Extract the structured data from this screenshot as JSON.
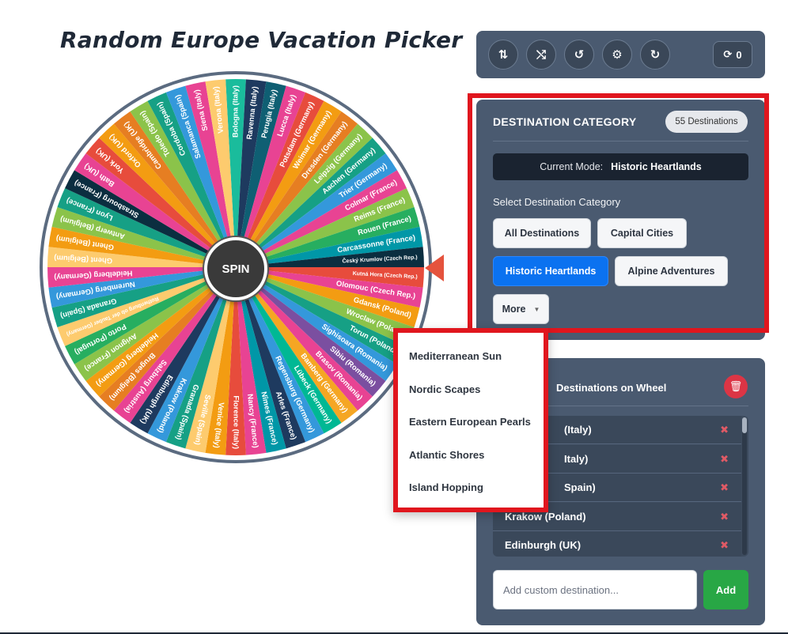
{
  "title": "Random Europe Vacation Picker",
  "wheel": {
    "spin_label": "SPIN",
    "segments": [
      {
        "label": "Bologna (Italy)",
        "color": "#1abc9c"
      },
      {
        "label": "Ravenna (Italy)",
        "color": "#1e3a5f"
      },
      {
        "label": "Perugia (Italy)",
        "color": "#0f5f73"
      },
      {
        "label": "Lucca (Italy)",
        "color": "#e84393"
      },
      {
        "label": "Potsdam (Germany)",
        "color": "#e74c3c"
      },
      {
        "label": "Weimar (Germany)",
        "color": "#f39c12"
      },
      {
        "label": "Dresden (Germany)",
        "color": "#e67e22"
      },
      {
        "label": "Leipzig (Germany)",
        "color": "#8bc34a"
      },
      {
        "label": "Aachen (Germany)",
        "color": "#16a085"
      },
      {
        "label": "Trier (Germany)",
        "color": "#3498db"
      },
      {
        "label": "Colmar (France)",
        "color": "#e84393"
      },
      {
        "label": "Reims (France)",
        "color": "#8bc34a"
      },
      {
        "label": "Rouen (France)",
        "color": "#27ae60"
      },
      {
        "label": "Carcassonne (France)",
        "color": "#0097a7"
      },
      {
        "label": "Český Krumlov (Czech Rep.)",
        "color": "#0b2e40"
      },
      {
        "label": "Kutná Hora (Czech Rep.)",
        "color": "#e74c3c"
      },
      {
        "label": "Olomouc (Czech Rep.)",
        "color": "#e84393"
      },
      {
        "label": "Gdansk (Poland)",
        "color": "#f39c12"
      },
      {
        "label": "Wroclaw (Poland)",
        "color": "#8bc34a"
      },
      {
        "label": "Torun (Poland)",
        "color": "#16a085"
      },
      {
        "label": "Sighisoara (Romania)",
        "color": "#3498db"
      },
      {
        "label": "Sibiu (Romania)",
        "color": "#7b4fa0"
      },
      {
        "label": "Brasov (Romania)",
        "color": "#e84393"
      },
      {
        "label": "Bamberg (Germany)",
        "color": "#f5a623"
      },
      {
        "label": "Lübeck (Germany)",
        "color": "#00b894"
      },
      {
        "label": "Regensburg (Germany)",
        "color": "#3498db"
      },
      {
        "label": "Arles (France)",
        "color": "#1e3a5f"
      },
      {
        "label": "Nîmes (France)",
        "color": "#0097a7"
      },
      {
        "label": "Nancy (France)",
        "color": "#e84393"
      },
      {
        "label": "Florence (Italy)",
        "color": "#e74c3c"
      },
      {
        "label": "Venice (Italy)",
        "color": "#f39c12"
      },
      {
        "label": "Seville (Spain)",
        "color": "#fdcb6e"
      },
      {
        "label": "Granada (Spain)",
        "color": "#16a085"
      },
      {
        "label": "Krakow (Poland)",
        "color": "#3498db"
      },
      {
        "label": "Edinburgh (UK)",
        "color": "#1e3a5f"
      },
      {
        "label": "Salzburg (Austria)",
        "color": "#e84393"
      },
      {
        "label": "Bruges (Belgium)",
        "color": "#e67e22"
      },
      {
        "label": "Heidelberg (Germany)",
        "color": "#f39c12"
      },
      {
        "label": "Avignon (France)",
        "color": "#8bc34a"
      },
      {
        "label": "Porto (Portugal)",
        "color": "#27ae60"
      },
      {
        "label": "Rothenburg ob der Tauber (Germany)",
        "color": "#fdcb6e"
      },
      {
        "label": "Granada (Spain)",
        "color": "#16a085"
      },
      {
        "label": "Nuremberg (Germany)",
        "color": "#3498db"
      },
      {
        "label": "Heidelberg (Germany)",
        "color": "#e84393"
      },
      {
        "label": "Ghent (Belgium)",
        "color": "#fdcb6e"
      },
      {
        "label": "Ghent (Belgium)",
        "color": "#f39c12"
      },
      {
        "label": "Antwerp (Belgium)",
        "color": "#8bc34a"
      },
      {
        "label": "Lyon (France)",
        "color": "#16a085"
      },
      {
        "label": "Strasbourg (France)",
        "color": "#0b2e40"
      },
      {
        "label": "Bath (UK)",
        "color": "#e84393"
      },
      {
        "label": "York (UK)",
        "color": "#e74c3c"
      },
      {
        "label": "Oxford (UK)",
        "color": "#f39c12"
      },
      {
        "label": "Cambridge (UK)",
        "color": "#e67e22"
      },
      {
        "label": "Toledo (Spain)",
        "color": "#8bc34a"
      },
      {
        "label": "Cordoba (Spain)",
        "color": "#16a085"
      },
      {
        "label": "Salamanca (Spain)",
        "color": "#3498db"
      },
      {
        "label": "Siena (Italy)",
        "color": "#e84393"
      },
      {
        "label": "Verona (Italy)",
        "color": "#fdcb6e"
      }
    ]
  },
  "toolbar": {
    "buttons": [
      {
        "name": "sort-icon",
        "glyph": "⇅"
      },
      {
        "name": "shuffle-icon",
        "glyph": "⤭"
      },
      {
        "name": "history-icon",
        "glyph": "↺"
      },
      {
        "name": "gear-icon",
        "glyph": "⚙"
      },
      {
        "name": "redo-icon",
        "glyph": "↻"
      }
    ],
    "spin_count_glyph": "⟳",
    "spin_count": "0"
  },
  "category": {
    "title": "DESTINATION CATEGORY",
    "badge": "55 Destinations",
    "mode_label": "Current Mode:",
    "mode_value": "Historic Heartlands",
    "select_label": "Select Destination Category",
    "buttons": {
      "all": "All Destinations",
      "capital": "Capital Cities",
      "historic": "Historic Heartlands",
      "alpine": "Alpine Adventures",
      "more": "More",
      "more_caret": "▼"
    }
  },
  "dropdown": {
    "items": [
      "Mediterranean Sun",
      "Nordic Scapes",
      "Eastern European Pearls",
      "Atlantic Shores",
      "Island Hopping"
    ]
  },
  "destinations": {
    "title": "Destinations on Wheel",
    "trash_glyph": "🗑",
    "remove_glyph": "✖",
    "rows": [
      "Seville (Italy)",
      "Venice (Italy)",
      "Seville (Spain)",
      "Krakow (Poland)",
      "Edinburgh (UK)"
    ],
    "visible_row_text": [
      "(Italy)",
      "Italy)",
      "Spain)",
      "Krakow (Poland)",
      "Edinburgh (UK)"
    ],
    "input_placeholder": "Add custom destination...",
    "add_label": "Add"
  },
  "colors": {
    "panel": "#4a5a70",
    "active": "#0b72f0",
    "highlight": "#e0161e",
    "add": "#28a745",
    "delete": "#dc3545"
  }
}
